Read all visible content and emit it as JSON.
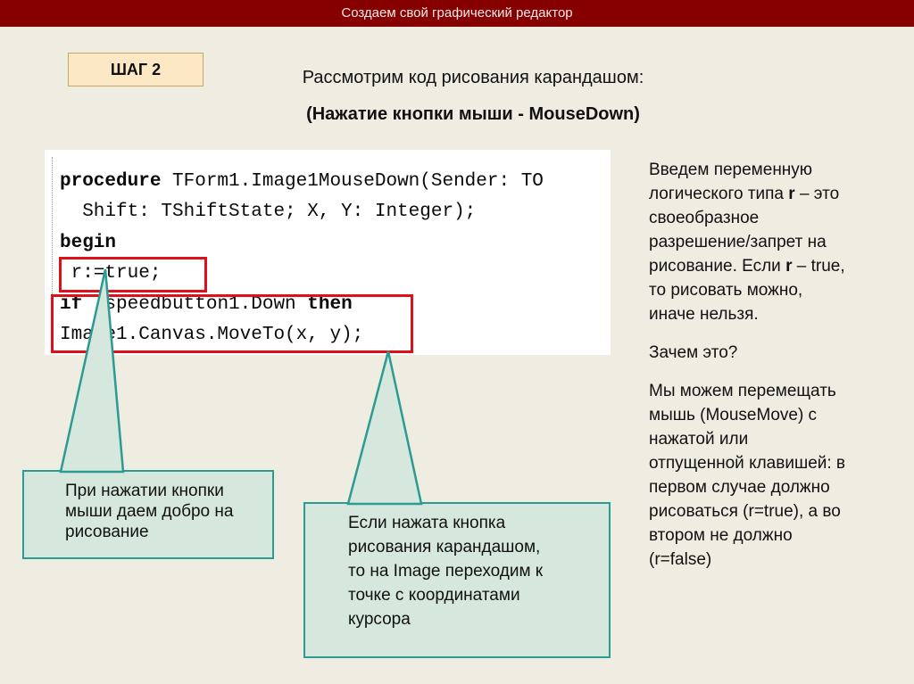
{
  "header": {
    "title": "Создаем свой графический редактор"
  },
  "step": {
    "label": "ШАГ 2"
  },
  "heading": {
    "line1": "Рассмотрим код рисования карандашом:",
    "line2": "(Нажатие кнопки мыши - MouseDown)"
  },
  "code": {
    "line1_kw": "procedure",
    "line1_rest": " TForm1.Image1MouseDown(Sender: TO",
    "line2": "  Shift: TShiftState; X, Y: Integer);",
    "line3_kw": "begin",
    "line4": " r:=true;",
    "line5_kw1": "if",
    "line5_mid": "  speedbutton1.Down ",
    "line5_kw2": "then",
    "line6": "Image1.Canvas.MoveTo(x, y);"
  },
  "callout_left": [
    "При нажатии кнопки",
    "мыши даем добро на",
    "рисование"
  ],
  "callout_right": [
    "Если нажата кнопка",
    "рисования карандашом,",
    "то на Image переходим к",
    "точке с координатами",
    "курсора"
  ],
  "right_text": {
    "p1_lines": [
      "Введем переменную",
      "логического типа ",
      "r",
      " – это",
      "своеобразное",
      "разрешение/запрет на",
      "рисование. Если ",
      "r",
      " – true,",
      "то рисовать можно,",
      "иначе нельзя."
    ],
    "p2": "Зачем это?",
    "p3_lines": [
      "Мы можем перемещать",
      "мышь (MouseMove) с",
      "нажатой или",
      "отпущенной клавишей: в",
      "первом случае должно",
      "рисоваться (r=true), а во",
      "втором не должно",
      "(r=false)"
    ]
  },
  "colors": {
    "header_bg": "#860000",
    "page_bg": "#efece1",
    "highlight_border": "#e0101a",
    "callout_bg": "#d6e7dd",
    "callout_border": "#2b9b94",
    "step_bg": "#fde8c6"
  }
}
